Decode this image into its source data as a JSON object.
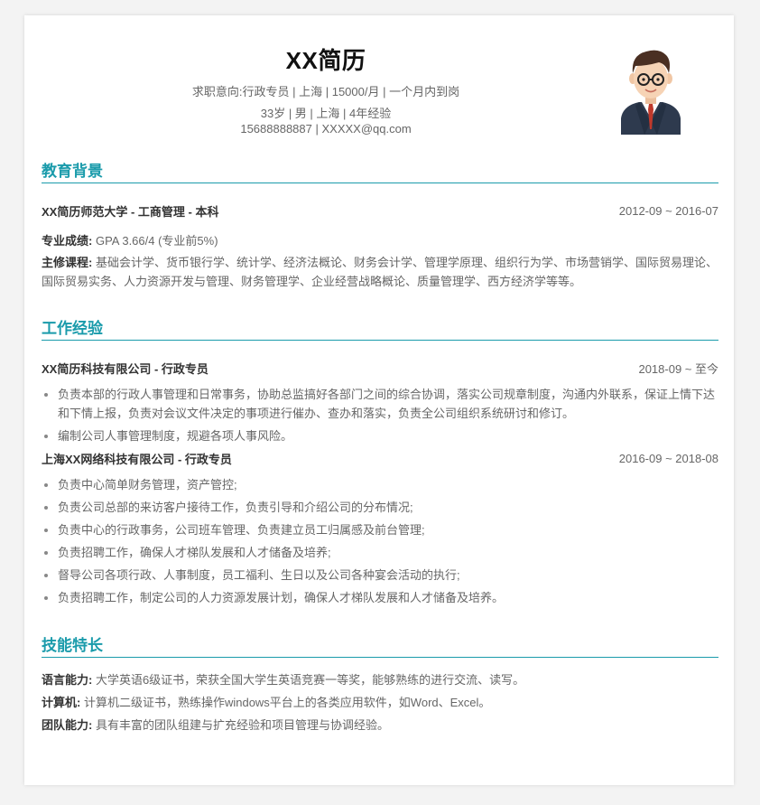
{
  "header": {
    "name": "XX简历",
    "line1": "求职意向:行政专员 | 上海 | 15000/月 | 一个月内到岗",
    "line2": "33岁 | 男 | 上海 | 4年经验",
    "line3": "15688888887 | XXXXX@qq.com"
  },
  "education": {
    "title": "教育背景",
    "school": "XX简历师范大学 - 工商管理 - 本科",
    "date": "2012-09 ~ 2016-07",
    "gpa_label": "专业成绩:",
    "gpa_value": " GPA 3.66/4 (专业前5%)",
    "courses_label": "主修课程:",
    "courses_value": " 基础会计学、货币银行学、统计学、经济法概论、财务会计学、管理学原理、组织行为学、市场营销学、国际贸易理论、国际贸易实务、人力资源开发与管理、财务管理学、企业经营战略概论、质量管理学、西方经济学等等。"
  },
  "work": {
    "title": "工作经验",
    "jobs": [
      {
        "company": "XX简历科技有限公司 - 行政专员",
        "date": "2018-09 ~ 至今",
        "items": [
          "负责本部的行政人事管理和日常事务，协助总监搞好各部门之间的综合协调，落实公司规章制度，沟通内外联系，保证上情下达和下情上报，负责对会议文件决定的事项进行催办、查办和落实，负责全公司组织系统研讨和修订。",
          "编制公司人事管理制度，规避各项人事风险。"
        ]
      },
      {
        "company": "上海XX网络科技有限公司 - 行政专员",
        "date": "2016-09 ~ 2018-08",
        "items": [
          "负责中心简单财务管理，资产管控;",
          "负责公司总部的来访客户接待工作，负责引导和介绍公司的分布情况;",
          "负责中心的行政事务，公司班车管理、负责建立员工归属感及前台管理;",
          "负责招聘工作，确保人才梯队发展和人才储备及培养;",
          "督导公司各项行政、人事制度，员工福利、生日以及公司各种宴会活动的执行;",
          "负责招聘工作，制定公司的人力资源发展计划，确保人才梯队发展和人才储备及培养。"
        ]
      }
    ]
  },
  "skills": {
    "title": "技能特长",
    "items": [
      {
        "label": "语言能力:",
        "value": " 大学英语6级证书，荣获全国大学生英语竞赛一等奖，能够熟练的进行交流、读写。"
      },
      {
        "label": "计算机:",
        "value": " 计算机二级证书，熟练操作windows平台上的各类应用软件，如Word、Excel。"
      },
      {
        "label": "团队能力:",
        "value": " 具有丰富的团队组建与扩充经验和项目管理与协调经验。"
      }
    ]
  },
  "avatar": {
    "icon": "avatar-man-glasses-icon",
    "colors": {
      "suit": "#2e3a4e",
      "tie": "#c0392b",
      "hair": "#4a2f22",
      "skin": "#f6d3b5"
    }
  }
}
